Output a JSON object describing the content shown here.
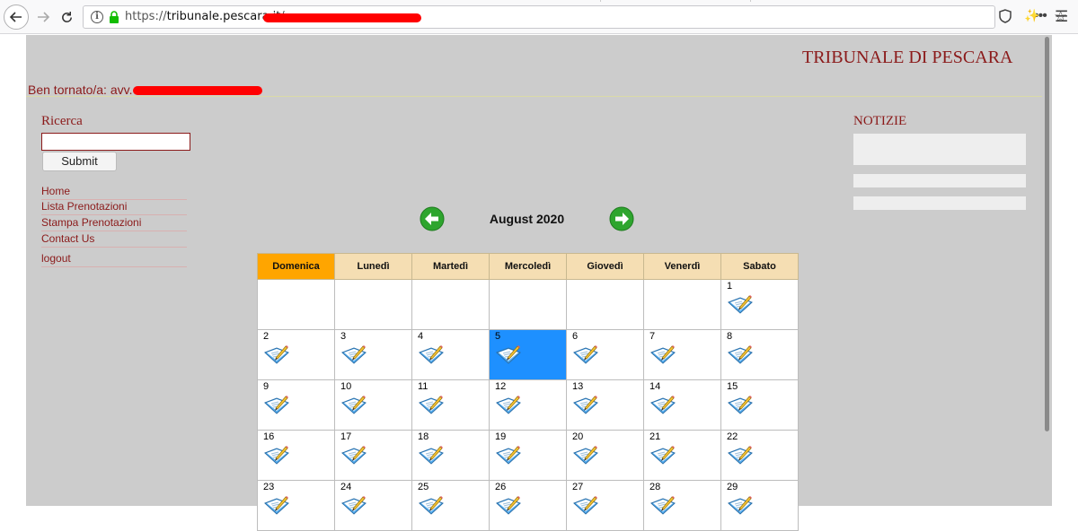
{
  "browser": {
    "url_prefix": "https://",
    "url_host": "tribunale.pescara.it",
    "url_rest": "/"
  },
  "site": {
    "title": "TRIBUNALE DI PESCARA",
    "welcome": "Ben tornato/a: avv."
  },
  "search": {
    "title": "Ricerca",
    "value": "",
    "submit_label": "Submit"
  },
  "nav": [
    {
      "label": "Home"
    },
    {
      "label": "Lista Prenotazioni"
    },
    {
      "label": "Stampa Prenotazioni"
    },
    {
      "label": "Contact Us"
    },
    {
      "label": "logout"
    }
  ],
  "news": {
    "title": "NOTIZIE"
  },
  "calendar": {
    "title": "August 2020",
    "weekdays": [
      "Domenica",
      "Lunedì",
      "Martedì",
      "Mercoledì",
      "Giovedì",
      "Venerdì",
      "Sabato"
    ],
    "today": 5,
    "weeks": [
      [
        "",
        "",
        "",
        "",
        "",
        "",
        "1"
      ],
      [
        "2",
        "3",
        "4",
        "5",
        "6",
        "7",
        "8"
      ],
      [
        "9",
        "10",
        "11",
        "12",
        "13",
        "14",
        "15"
      ],
      [
        "16",
        "17",
        "18",
        "19",
        "20",
        "21",
        "22"
      ],
      [
        "23",
        "24",
        "25",
        "26",
        "27",
        "28",
        "29"
      ]
    ]
  },
  "colors": {
    "brand": "#8b1a1a",
    "header_bg": "#f5deb3",
    "sunday_bg": "#ffa500",
    "today_bg": "#1e90ff",
    "nav_arrow": "#2ea52e"
  }
}
